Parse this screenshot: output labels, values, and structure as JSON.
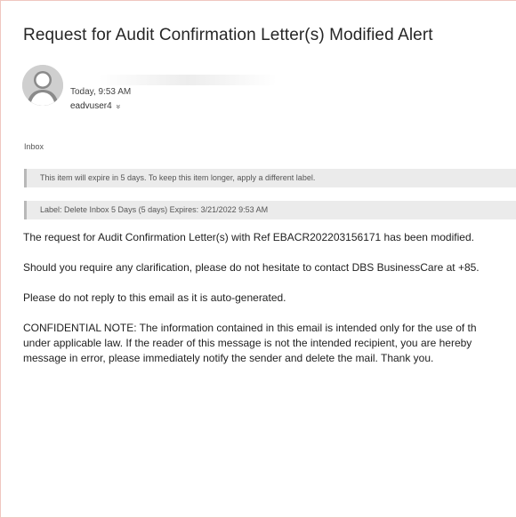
{
  "email": {
    "subject": "Request for Audit Confirmation Letter(s) Modified Alert",
    "timestamp": "Today, 9:53 AM",
    "recipient": "eadvuser4",
    "folder": "Inbox",
    "expiry_notice": "This item will expire in 5 days. To keep this item longer, apply a different label.",
    "label_notice": "Label: Delete Inbox 5 Days (5 days) Expires: 3/21/2022 9:53 AM",
    "body": {
      "line1": "The request for Audit Confirmation Letter(s) with Ref EBACR202203156171 has been modified.",
      "line2": "Should you require any clarification, please do not hesitate to contact DBS BusinessCare at +85.",
      "line3": "Please do not reply to this email as it is auto-generated.",
      "confidential1": "CONFIDENTIAL NOTE: The information contained in this email is intended only for the use of th",
      "confidential2": "under applicable law. If the reader of this message is not the intended recipient, you are hereby",
      "confidential3": "message in error, please immediately notify the sender and delete the mail. Thank you."
    }
  },
  "icons": {
    "avatar": "person-avatar-icon",
    "expand": "chevron-double-down-icon"
  },
  "colors": {
    "info_bar_bg": "#ebebeb",
    "info_bar_accent": "#b8b8b8",
    "frame_border": "#f0c7c0"
  }
}
